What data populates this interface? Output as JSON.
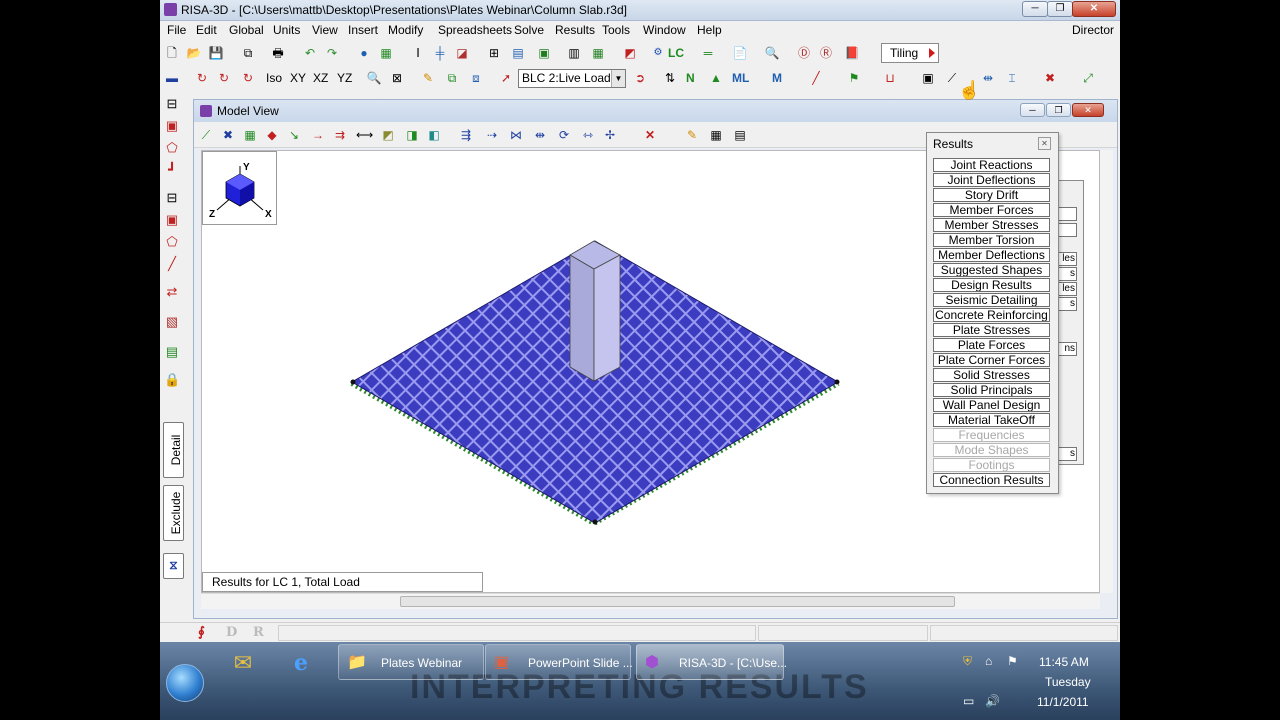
{
  "app": {
    "title": "RISA-3D - [C:\\Users\\mattb\\Desktop\\Presentations\\Plates Webinar\\Column Slab.r3d]"
  },
  "window_controls": {
    "minimize": "─",
    "maximize": "❐",
    "close": "✕"
  },
  "menu": {
    "items": [
      "File",
      "Edit",
      "Global",
      "Units",
      "View",
      "Insert",
      "Modify",
      "Spreadsheets",
      "Solve",
      "Results",
      "Tools",
      "Window",
      "Help"
    ],
    "right_label": "Director"
  },
  "toolbar2": {
    "text_buttons": [
      "Iso",
      "XY",
      "XZ",
      "YZ"
    ],
    "load_select": "BLC 2:Live Load",
    "lc_label": "LC",
    "n_label": "N",
    "ml_label": "ML",
    "m_label": "M"
  },
  "tiling": {
    "label": "Tiling"
  },
  "left_tabs": {
    "detail": "Detail",
    "exclude": "Exclude"
  },
  "model_view": {
    "title": "Model View",
    "status": "Results for LC 1, Total Load",
    "axes": {
      "x": "X",
      "y": "Y",
      "z": "Z"
    }
  },
  "results_panel": {
    "title": "Results",
    "close": "✕",
    "buttons": [
      {
        "label": "Joint Reactions",
        "enabled": true
      },
      {
        "label": "Joint Deflections",
        "enabled": true
      },
      {
        "label": "Story Drift",
        "enabled": true
      },
      {
        "label": "Member Forces",
        "enabled": true
      },
      {
        "label": "Member Stresses",
        "enabled": true
      },
      {
        "label": "Member Torsion",
        "enabled": true
      },
      {
        "label": "Member Deflections",
        "enabled": true
      },
      {
        "label": "Suggested Shapes",
        "enabled": true
      },
      {
        "label": "Design Results",
        "enabled": true
      },
      {
        "label": "Seismic Detailing",
        "enabled": true
      },
      {
        "label": "Concrete Reinforcing",
        "enabled": true
      },
      {
        "label": "Plate Stresses",
        "enabled": true
      },
      {
        "label": "Plate Forces",
        "enabled": true
      },
      {
        "label": "Plate Corner Forces",
        "enabled": true
      },
      {
        "label": "Solid Stresses",
        "enabled": true
      },
      {
        "label": "Solid Principals",
        "enabled": true
      },
      {
        "label": "Wall Panel Design",
        "enabled": true
      },
      {
        "label": "Material TakeOff",
        "enabled": true
      },
      {
        "label": "Frequencies",
        "enabled": false
      },
      {
        "label": "Mode Shapes",
        "enabled": false
      },
      {
        "label": "Footings",
        "enabled": false
      },
      {
        "label": "Connection Results",
        "enabled": true
      }
    ],
    "back_panel_fragments": [
      "les",
      "s",
      "les",
      "s",
      "ns",
      "s"
    ]
  },
  "statusbar": {
    "icons": [
      "D",
      "R"
    ]
  },
  "taskbar": {
    "watermark": "INTERPRETING RESULTS",
    "items": [
      {
        "label": "Plates Webinar",
        "icon": "folder-icon"
      },
      {
        "label": "PowerPoint Slide ...",
        "icon": "powerpoint-icon"
      },
      {
        "label": "RISA-3D - [C:\\Use...",
        "icon": "risa-icon"
      }
    ],
    "clock": {
      "time": "11:45 AM",
      "day": "Tuesday",
      "date": "11/1/2011"
    }
  }
}
